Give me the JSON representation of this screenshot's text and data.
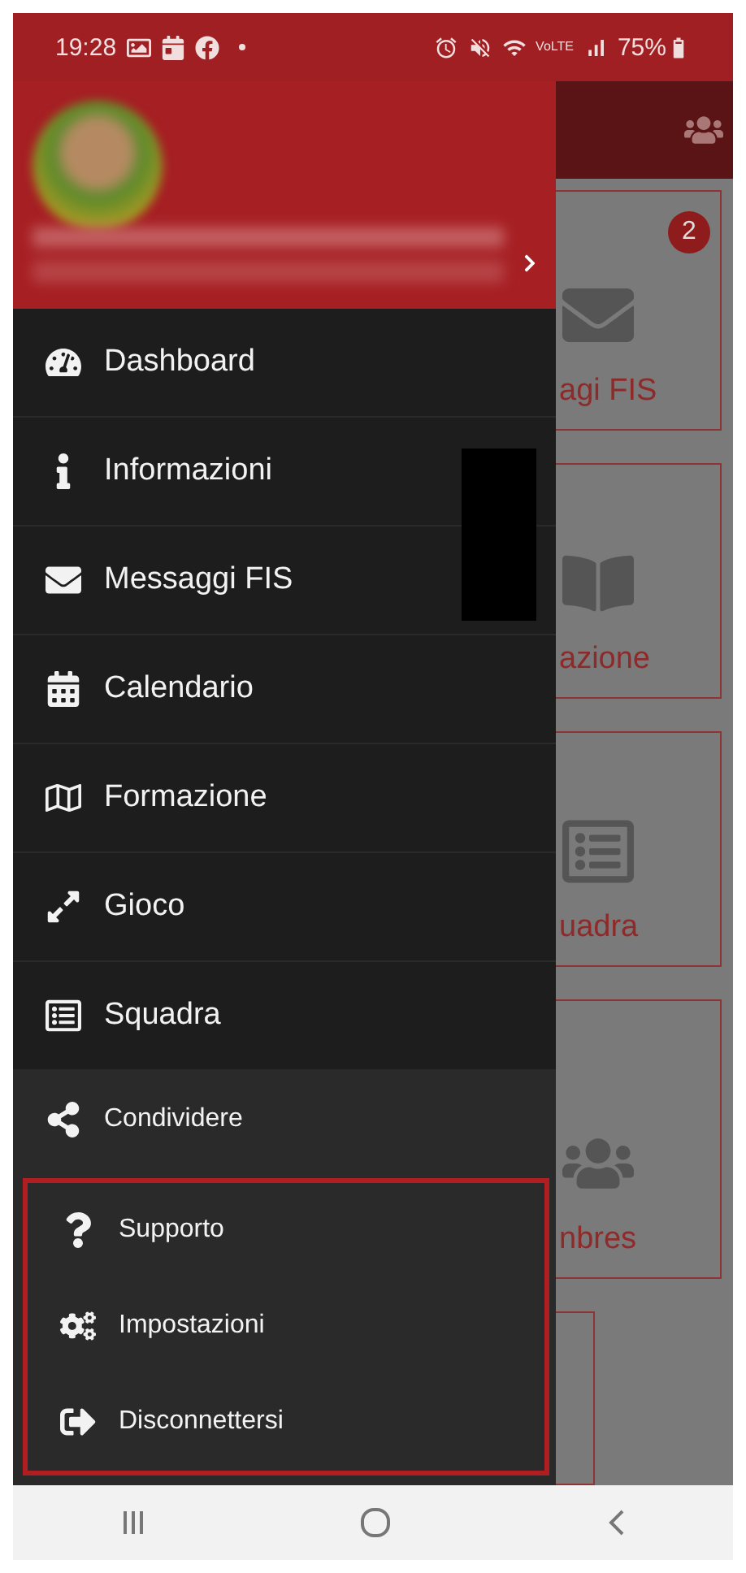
{
  "status_bar": {
    "time": "19:28",
    "network": "VoLTE",
    "battery": "75%"
  },
  "menu": [
    {
      "label": "Dashboard"
    },
    {
      "label": "Informazioni"
    },
    {
      "label": "Messaggi FIS"
    },
    {
      "label": "Calendario"
    },
    {
      "label": "Formazione"
    },
    {
      "label": "Gioco"
    },
    {
      "label": "Squadra"
    }
  ],
  "secondary_menu": [
    {
      "label": "Condividere"
    }
  ],
  "highlighted_menu": [
    {
      "label": "Supporto"
    },
    {
      "label": "Impostazioni"
    },
    {
      "label": "Disconnettersi"
    }
  ],
  "background_cards": [
    {
      "label": "agi FIS",
      "badge": "2"
    },
    {
      "label": "azione"
    },
    {
      "label": "uadra"
    },
    {
      "label": "nbres"
    }
  ]
}
